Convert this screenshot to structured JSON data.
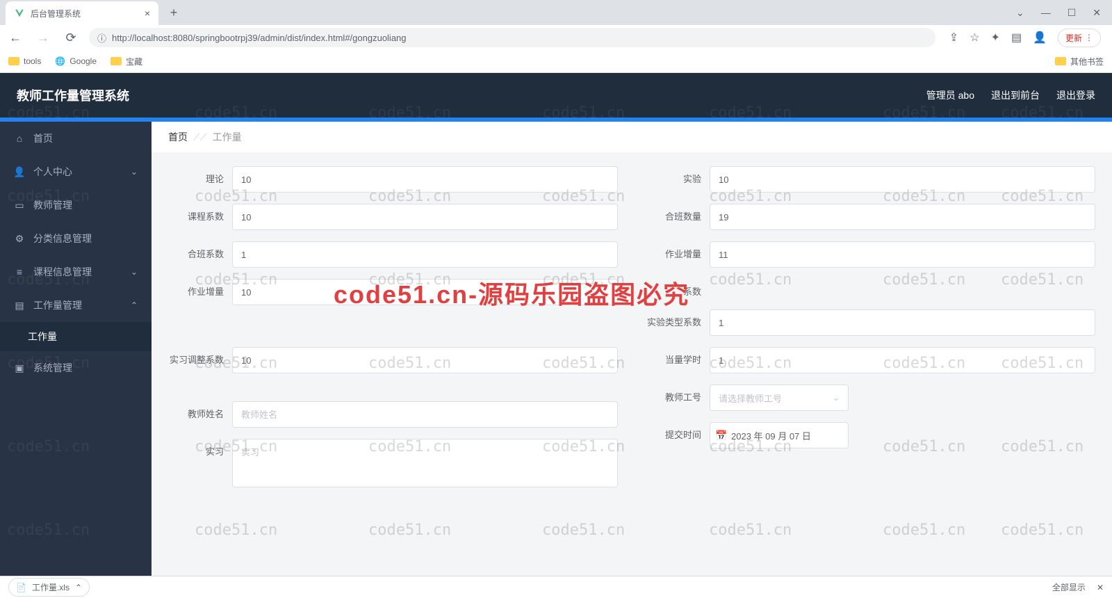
{
  "browser": {
    "tab_title": "后台管理系统",
    "url": "http://localhost:8080/springbootrpj39/admin/dist/index.html#/gongzuoliang",
    "update_label": "更新",
    "bookmarks": {
      "tools": "tools",
      "google": "Google",
      "baozang": "宝藏",
      "other": "其他书签"
    }
  },
  "header": {
    "title": "教师工作量管理系统",
    "user": "管理员 abo",
    "exit_front": "退出到前台",
    "logout": "退出登录"
  },
  "sidebar": {
    "items": [
      {
        "label": "首页"
      },
      {
        "label": "个人中心"
      },
      {
        "label": "教师管理"
      },
      {
        "label": "分类信息管理"
      },
      {
        "label": "课程信息管理"
      },
      {
        "label": "工作量管理"
      },
      {
        "label": "工作量"
      },
      {
        "label": "系统管理"
      }
    ]
  },
  "breadcrumb": {
    "home": "首页",
    "current": "工作量"
  },
  "form": {
    "left": {
      "lilun": {
        "label": "理论",
        "value": "10"
      },
      "kecheng_xishu": {
        "label": "课程系数",
        "value": "10"
      },
      "heban_xishu": {
        "label": "合班系数",
        "value": "1"
      },
      "zuoye_zengliang": {
        "label": "作业增量",
        "value": "10"
      },
      "shixi_tiaozheng": {
        "label": "实习调整系数",
        "value": "10"
      },
      "jiaoshi_xingming": {
        "label": "教师姓名",
        "placeholder": "教师姓名"
      },
      "shixi": {
        "label": "实习",
        "placeholder": "实习"
      }
    },
    "right": {
      "shiyan": {
        "label": "实验",
        "value": "10"
      },
      "heban_shuliang": {
        "label": "合班数量",
        "value": "19"
      },
      "zuoye_zengliang": {
        "label": "作业增量",
        "value": "11"
      },
      "xishu1": {
        "label": "系数"
      },
      "shiyan_leixing": {
        "label": "实验类型系数",
        "value": "1"
      },
      "dangliang_xueshi": {
        "label": "当量学时",
        "value": "1"
      },
      "jiaoshi_gonghao": {
        "label": "教师工号",
        "placeholder": "请选择教师工号"
      },
      "tijiao_shijian": {
        "label": "提交时间",
        "value": "2023 年 09 月 07 日"
      }
    }
  },
  "download": {
    "file": "工作量.xls",
    "show_all": "全部显示"
  },
  "watermark": {
    "text": "code51.cn",
    "big": "code51.cn-源码乐园盗图必究"
  }
}
